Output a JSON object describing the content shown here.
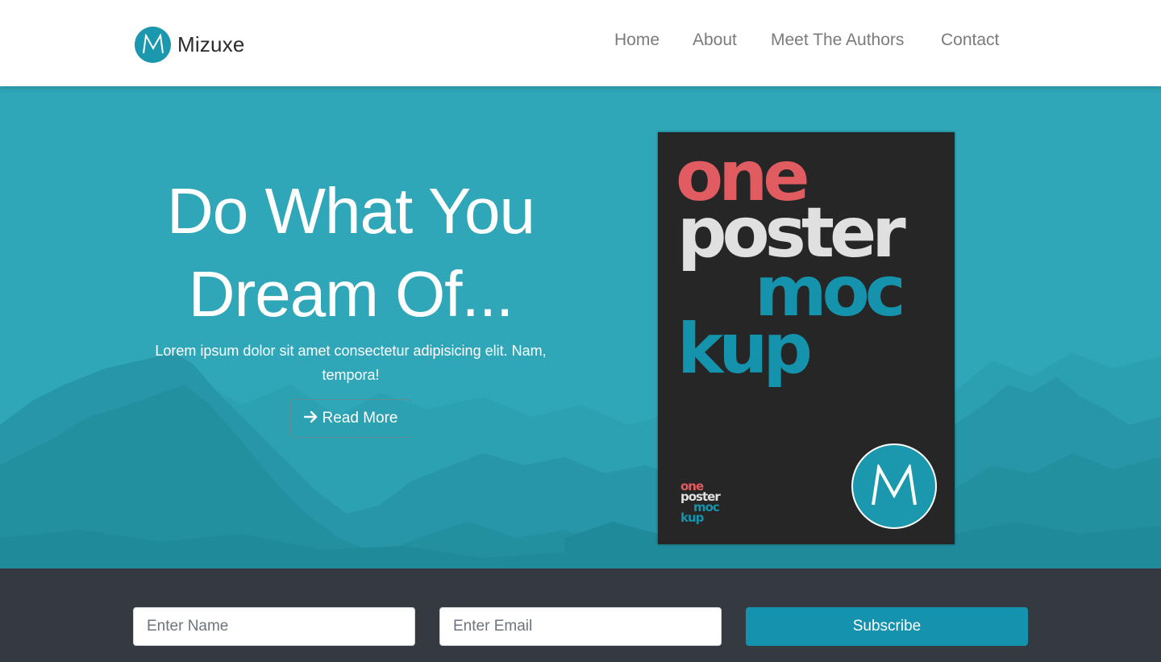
{
  "brand": {
    "name": "Mizuxe",
    "logo_icon": "m-logo-icon",
    "logo_color": "#1b98ad"
  },
  "nav": {
    "items": [
      {
        "label": "Home"
      },
      {
        "label": "About"
      },
      {
        "label": "Meet The Authors"
      },
      {
        "label": "Contact"
      }
    ]
  },
  "hero": {
    "title_line1": "Do What You",
    "title_line2": "Dream Of...",
    "subtitle": "Lorem ipsum dolor sit amet consectetur adipisicing elit. Nam, tempora!",
    "button_label": "Read More",
    "button_icon": "arrow-right-icon",
    "background_color": "#2fa7b9"
  },
  "poster": {
    "words": [
      "one",
      "poster",
      "moc",
      "kup"
    ],
    "small_words": [
      "one",
      "poster",
      "moc",
      "kup"
    ],
    "badge_icon": "m-logo-icon",
    "colors": {
      "one": "#e05c60",
      "poster": "#e0e0e0",
      "mockup": "#1593ad",
      "background": "#262626"
    }
  },
  "subscribe": {
    "name_placeholder": "Enter Name",
    "email_placeholder": "Enter Email",
    "button_label": "Subscribe",
    "bar_color": "#343a40",
    "button_color": "#1592ad"
  }
}
